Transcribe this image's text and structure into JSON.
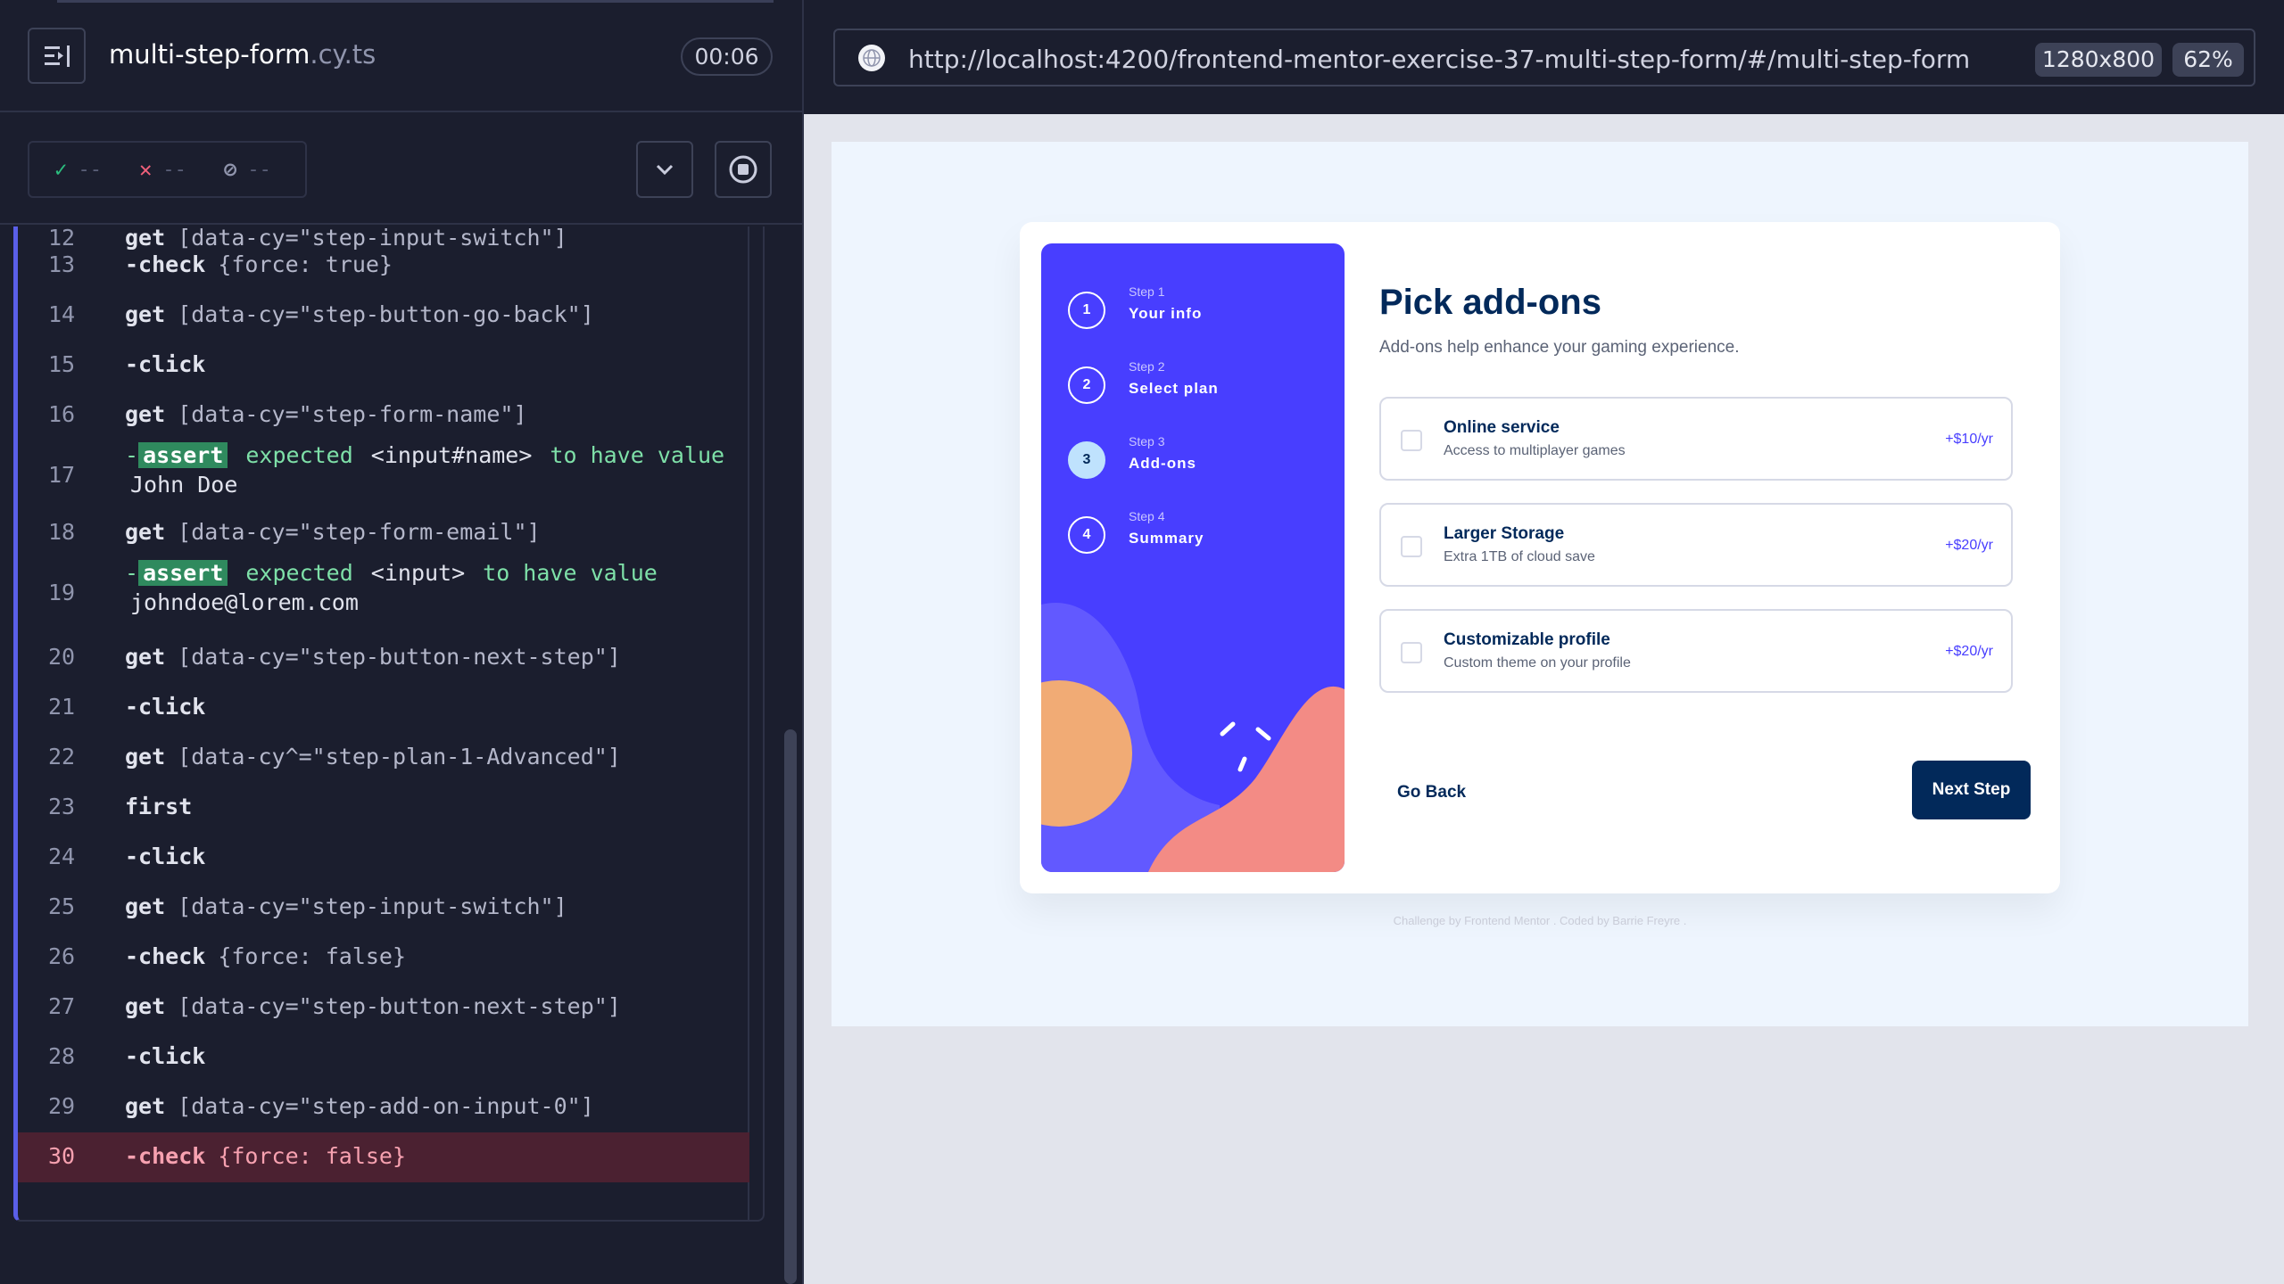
{
  "spec": {
    "filename": "multi-step-form",
    "extension": ".cy.ts",
    "timer": "00:06"
  },
  "stats": {
    "passed": "--",
    "failed": "--",
    "skipped": "--"
  },
  "commands": [
    {
      "num": "12",
      "parts": [
        {
          "t": "name",
          "v": "get"
        },
        {
          "t": "sel",
          "v": "[data-cy=\"step-input-switch\"]"
        }
      ]
    },
    {
      "num": "13",
      "parts": [
        {
          "t": "name",
          "v": "-check"
        },
        {
          "t": "sel",
          "v": "{force: true}"
        }
      ]
    },
    {
      "num": "14",
      "parts": [
        {
          "t": "name",
          "v": "get"
        },
        {
          "t": "sel",
          "v": "[data-cy=\"step-button-go-back\"]"
        }
      ]
    },
    {
      "num": "15",
      "parts": [
        {
          "t": "name",
          "v": "-click"
        }
      ]
    },
    {
      "num": "16",
      "parts": [
        {
          "t": "name",
          "v": "get"
        },
        {
          "t": "sel",
          "v": "[data-cy=\"step-form-name\"]"
        }
      ]
    },
    {
      "num": "17",
      "assert": true,
      "line1": {
        "pre": "expected",
        "strong": "<input#name>",
        "post": "to have value"
      },
      "line2": "John Doe"
    },
    {
      "num": "18",
      "parts": [
        {
          "t": "name",
          "v": "get"
        },
        {
          "t": "sel",
          "v": "[data-cy=\"step-form-email\"]"
        }
      ]
    },
    {
      "num": "19",
      "assert": true,
      "line1": {
        "pre": "expected",
        "strong": "<input>",
        "post": "to have value"
      },
      "line2": "johndoe@lorem.com"
    },
    {
      "num": "20",
      "parts": [
        {
          "t": "name",
          "v": "get"
        },
        {
          "t": "sel",
          "v": "[data-cy=\"step-button-next-step\"]"
        }
      ]
    },
    {
      "num": "21",
      "parts": [
        {
          "t": "name",
          "v": "-click"
        }
      ]
    },
    {
      "num": "22",
      "parts": [
        {
          "t": "name",
          "v": "get"
        },
        {
          "t": "sel",
          "v": "[data-cy^=\"step-plan-1-Advanced\"]"
        }
      ]
    },
    {
      "num": "23",
      "parts": [
        {
          "t": "name",
          "v": "first"
        }
      ]
    },
    {
      "num": "24",
      "parts": [
        {
          "t": "name",
          "v": "-click"
        }
      ]
    },
    {
      "num": "25",
      "parts": [
        {
          "t": "name",
          "v": "get"
        },
        {
          "t": "sel",
          "v": "[data-cy=\"step-input-switch\"]"
        }
      ]
    },
    {
      "num": "26",
      "parts": [
        {
          "t": "name",
          "v": "-check"
        },
        {
          "t": "sel",
          "v": "{force: false}"
        }
      ]
    },
    {
      "num": "27",
      "parts": [
        {
          "t": "name",
          "v": "get"
        },
        {
          "t": "sel",
          "v": "[data-cy=\"step-button-next-step\"]"
        }
      ]
    },
    {
      "num": "28",
      "parts": [
        {
          "t": "name",
          "v": "-click"
        }
      ]
    },
    {
      "num": "29",
      "parts": [
        {
          "t": "name",
          "v": "get"
        },
        {
          "t": "sel",
          "v": "[data-cy=\"step-add-on-input-0\"]"
        }
      ]
    },
    {
      "num": "30",
      "active": true,
      "parts": [
        {
          "t": "name",
          "v": "-check"
        },
        {
          "t": "sel",
          "v": "{force: false}"
        }
      ]
    }
  ],
  "assert_label": "assert",
  "browser": {
    "url": "http://localhost:4200/frontend-mentor-exercise-37-multi-step-form/#/multi-step-form",
    "viewport": "1280x800",
    "zoom": "62%"
  },
  "app": {
    "steps": [
      {
        "number": "1",
        "label": "Step 1",
        "title": "Your info"
      },
      {
        "number": "2",
        "label": "Step 2",
        "title": "Select plan"
      },
      {
        "number": "3",
        "label": "Step 3",
        "title": "Add-ons",
        "active": true
      },
      {
        "number": "4",
        "label": "Step 4",
        "title": "Summary"
      }
    ],
    "title": "Pick add-ons",
    "subtitle": "Add-ons help enhance your gaming experience.",
    "addons": [
      {
        "name": "Online service",
        "desc": "Access to multiplayer games",
        "price": "+$10/yr"
      },
      {
        "name": "Larger Storage",
        "desc": "Extra 1TB of cloud save",
        "price": "+$20/yr"
      },
      {
        "name": "Customizable profile",
        "desc": "Custom theme on your profile",
        "price": "+$20/yr"
      }
    ],
    "go_back": "Go Back",
    "next_step": "Next Step",
    "attribution": "Challenge by Frontend Mentor . Coded by Barrie Freyre ."
  },
  "colors": {
    "panel_bg": "#1b1e2e",
    "active_row": "#4b2131",
    "sidebar": "#483eff",
    "primary": "#02295a",
    "active_step": "#bfe2fd"
  }
}
